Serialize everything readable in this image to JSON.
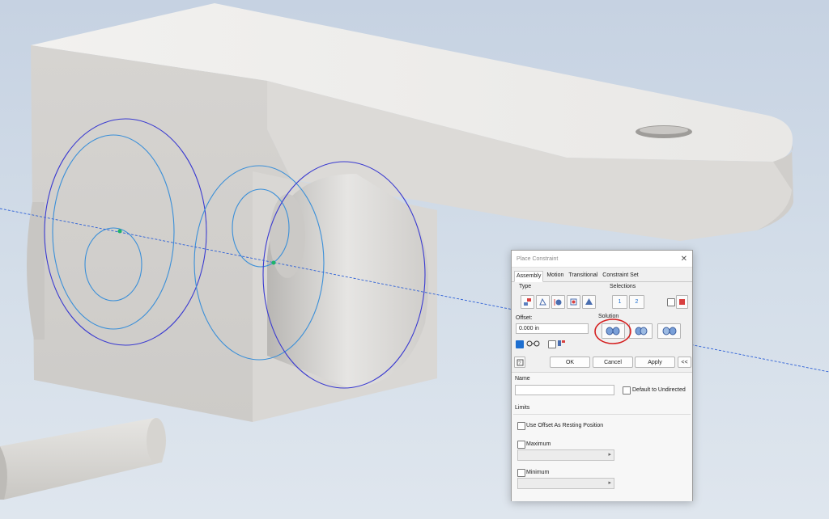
{
  "dialog": {
    "title": "Place Constraint",
    "close_glyph": "✕",
    "tabs": [
      "Assembly",
      "Motion",
      "Transitional",
      "Constraint Set"
    ],
    "type_label": "Type",
    "type_icons": [
      "mate-icon",
      "angle-icon",
      "tangent-icon",
      "insert-icon",
      "symmetry-icon"
    ],
    "selections_label": "Selections",
    "selection_1": "1",
    "selection_2": "2",
    "offset_label": "Offset:",
    "offset_value": "0.000 in",
    "solution_label": "Solution",
    "ok_label": "OK",
    "cancel_label": "Cancel",
    "apply_label": "Apply",
    "more_label": "<<",
    "name_label": "Name",
    "name_value": "",
    "default_undirected_label": "Default to Undirected",
    "limits_label": "Limits",
    "use_offset_label": "Use Offset As Resting Position",
    "maximum_label": "Maximum",
    "minimum_label": "Minimum",
    "preview_checked": true,
    "accent_color": "#1e6fd0",
    "annotation_color": "#d42020"
  }
}
